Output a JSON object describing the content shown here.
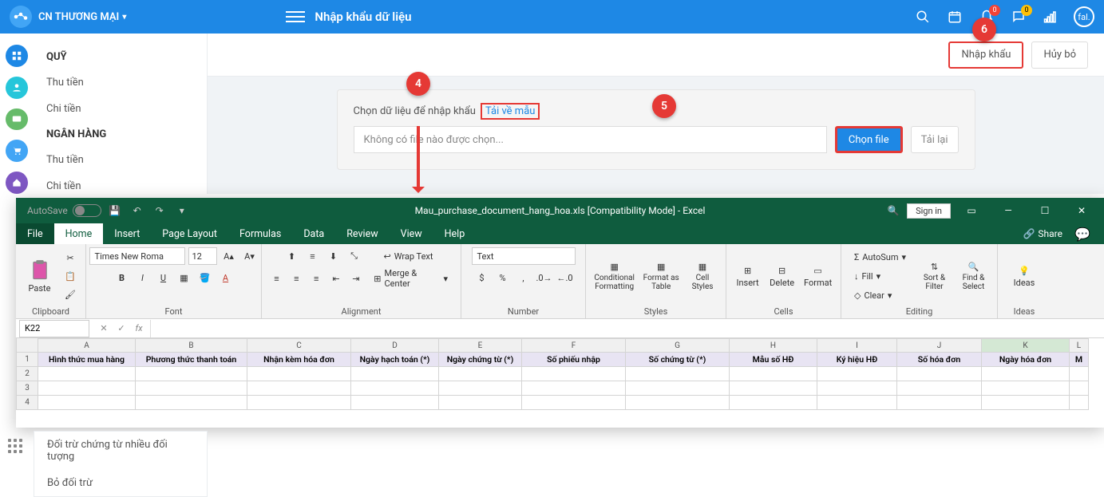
{
  "header": {
    "org_name": "CN THƯƠNG MẠI",
    "page_title": "Nhập khẩu dữ liệu",
    "avatar_text": "fal.",
    "bell_badge": "0",
    "msg_badge": "0"
  },
  "sidebar": {
    "sections": [
      {
        "heading": "QUỸ",
        "items": [
          "Thu tiền",
          "Chi tiền"
        ]
      },
      {
        "heading": "NGÂN HÀNG",
        "items": [
          "Thu tiền",
          "Chi tiền"
        ]
      }
    ]
  },
  "toolbar": {
    "import": "Nhập khẩu",
    "cancel": "Hủy bỏ"
  },
  "import_panel": {
    "label": "Chọn dữ liệu để nhập khẩu",
    "download_template": "Tải về mẫu",
    "placeholder": "Không có file nào được chọn...",
    "choose_file": "Chọn file",
    "reload": "Tải lại"
  },
  "markers": {
    "m4": "4",
    "m5": "5",
    "m6": "6"
  },
  "excel": {
    "autosave_label": "AutoSave",
    "autosave_state": "Off",
    "title": "Mau_purchase_document_hang_hoa.xls  [Compatibility Mode]  -  Excel",
    "sign_in": "Sign in",
    "tabs": [
      "File",
      "Home",
      "Insert",
      "Page Layout",
      "Formulas",
      "Data",
      "Review",
      "View",
      "Help"
    ],
    "share": "Share",
    "ribbon": {
      "clipboard": "Clipboard",
      "paste": "Paste",
      "font": "Font",
      "font_name": "Times New Roma",
      "font_size": "12",
      "alignment": "Alignment",
      "wrap": "Wrap Text",
      "merge": "Merge & Center",
      "number": "Number",
      "num_format": "Text",
      "styles": "Styles",
      "cond_fmt": "Conditional Formatting",
      "fmt_table": "Format as Table",
      "cell_styles": "Cell Styles",
      "cells": "Cells",
      "insert": "Insert",
      "delete": "Delete",
      "format": "Format",
      "editing": "Editing",
      "autosum": "AutoSum",
      "fill": "Fill",
      "clear": "Clear",
      "sort": "Sort & Filter",
      "find": "Find & Select",
      "ideas": "Ideas"
    },
    "name_box": "K22",
    "columns": [
      "A",
      "B",
      "C",
      "D",
      "E",
      "F",
      "G",
      "H",
      "I",
      "J",
      "K",
      "L"
    ],
    "header_row": [
      "Hình thức mua hàng",
      "Phương thức thanh toán",
      "Nhận kèm hóa đơn",
      "Ngày hạch toán (*)",
      "Ngày chứng từ (*)",
      "Số phiếu nhập",
      "Số chứng từ (*)",
      "Mẫu số HĐ",
      "Ký hiệu HĐ",
      "Số hóa đơn",
      "Ngày hóa đơn",
      "M"
    ],
    "row_nums": [
      "1",
      "2",
      "3",
      "4"
    ]
  },
  "float_sidebar": {
    "items": [
      "Đối trừ chứng từ nhiều đối tượng",
      "Bỏ đối trừ"
    ]
  }
}
